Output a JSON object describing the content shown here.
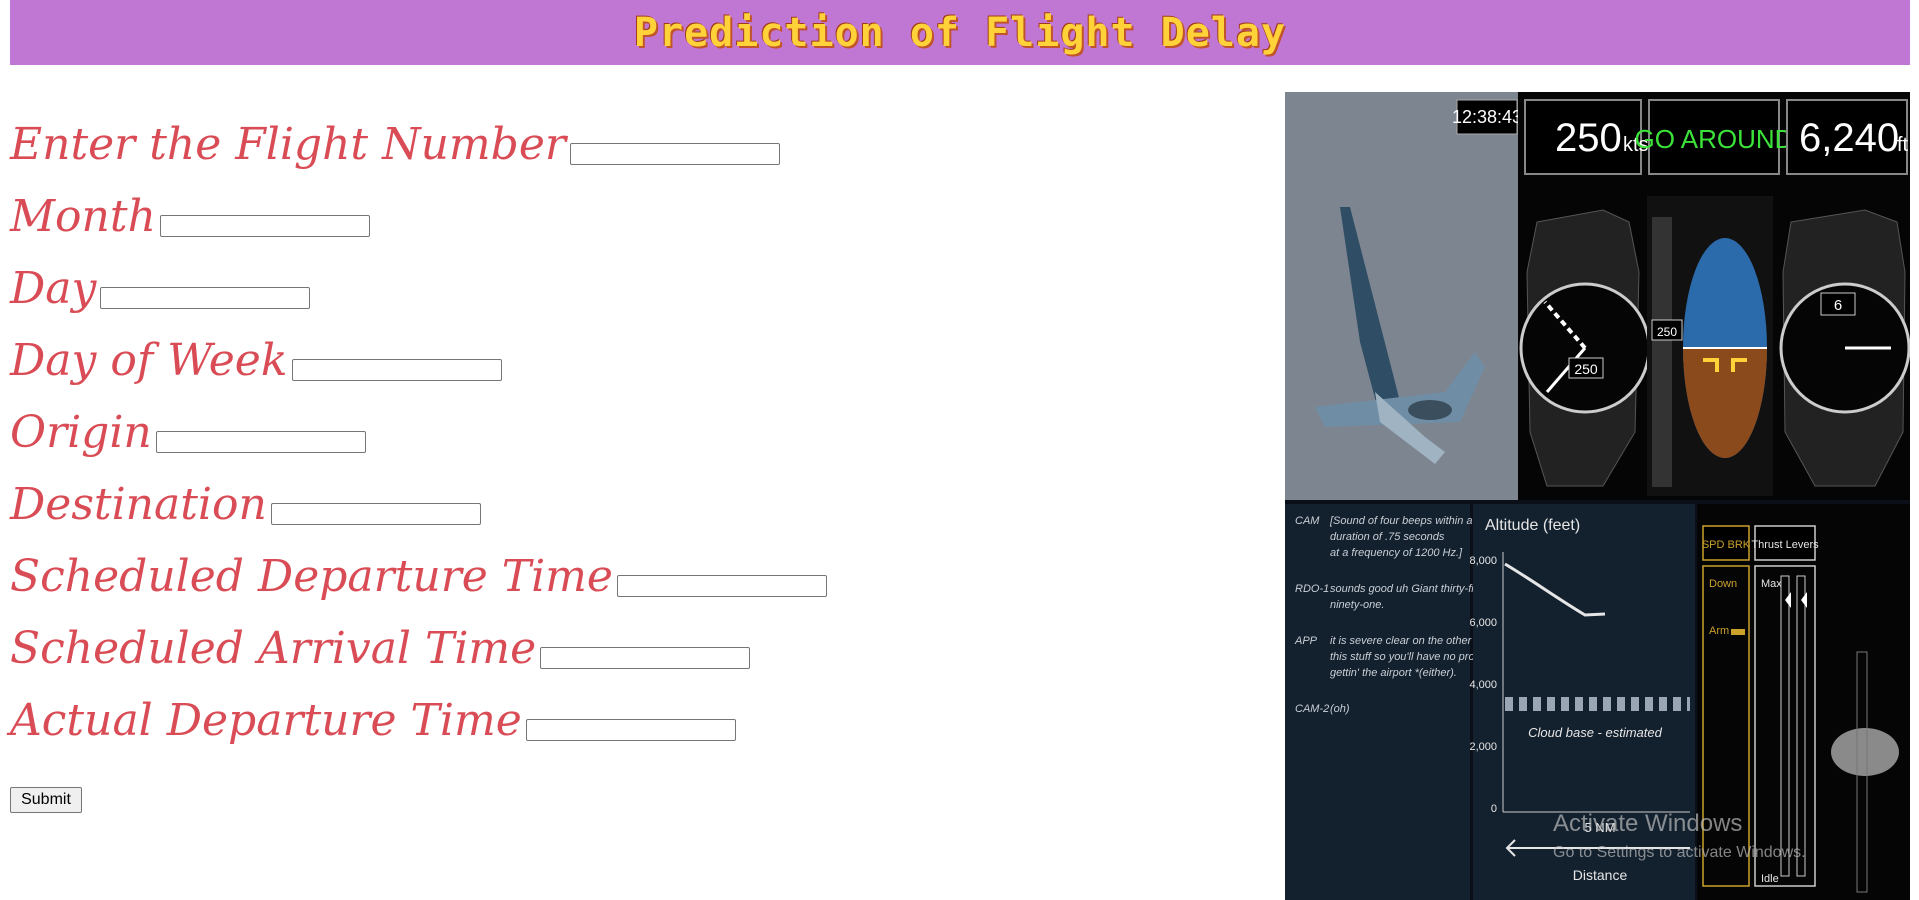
{
  "header": {
    "title": "Prediction of Flight Delay"
  },
  "form": {
    "fields": [
      {
        "label": "Enter the Flight Number",
        "value": ""
      },
      {
        "label": "Month",
        "value": ""
      },
      {
        "label": "Day",
        "value": ""
      },
      {
        "label": "Day of Week",
        "value": ""
      },
      {
        "label": "Origin",
        "value": ""
      },
      {
        "label": "Destination",
        "value": ""
      },
      {
        "label": "Scheduled Departure Time",
        "value": ""
      },
      {
        "label": "Scheduled Arrival Time",
        "value": ""
      },
      {
        "label": "Actual Departure Time",
        "value": ""
      }
    ],
    "submit_label": "Submit"
  },
  "panel": {
    "time": "12:38:43",
    "speed": "250",
    "speed_unit": "kts",
    "status": "GO AROUND",
    "altitude": "6,240",
    "altitude_unit": "ft",
    "airspeed_readout": "250",
    "speed_tape_readout": "250",
    "altimeter_readout": "6",
    "transcript": [
      {
        "who": "CAM",
        "lines": [
          "[Sound of four beeps within a",
          "duration of .75 seconds",
          "at a frequency of 1200 Hz.]"
        ]
      },
      {
        "who": "RDO-1",
        "lines": [
          "sounds good uh Giant thirty-five",
          "ninety-one."
        ]
      },
      {
        "who": "APP",
        "lines": [
          "it is severe clear on the other side of",
          "this stuff so you'll have no problem",
          "gettin' the airport *(either)."
        ]
      },
      {
        "who": "CAM-2",
        "lines": [
          "(oh)"
        ]
      }
    ],
    "alt_chart": {
      "title": "Altitude (feet)",
      "ticks": [
        "8,000",
        "6,000",
        "4,000",
        "2,000",
        "0"
      ],
      "cloud_label": "Cloud base - estimated",
      "distance_value": "5 NM",
      "distance_label": "Distance"
    },
    "controls": {
      "spd_brk": "SPD BRK",
      "thrust": "Thrust Levers",
      "down": "Down",
      "arm": "Arm",
      "max": "Max",
      "idle": "Idle"
    }
  },
  "watermark": {
    "title": "Activate Windows",
    "subtitle": "Go to Settings to activate Windows."
  }
}
